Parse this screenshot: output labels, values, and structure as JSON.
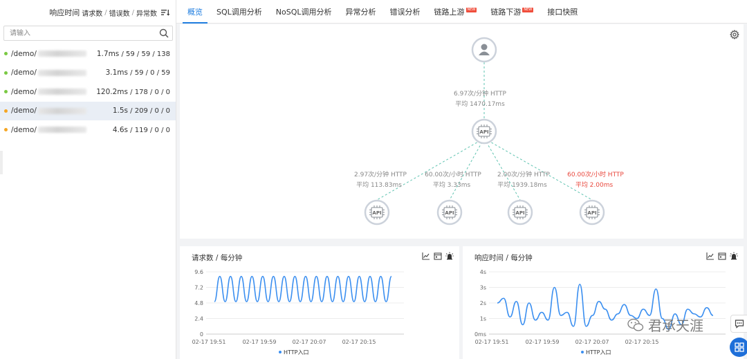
{
  "sort_bar": {
    "primary": "响应时间",
    "options": [
      "请求数",
      "错误数",
      "异常数"
    ],
    "sep": "/"
  },
  "search": {
    "placeholder": "请输入"
  },
  "endpoints": [
    {
      "path": "/demo/",
      "stats": "1.7ms",
      "counts": " / 59 / 59 / 138",
      "status": "ok",
      "active": false
    },
    {
      "path": "/demo/",
      "stats": "3.1ms",
      "counts": " / 59 / 0 / 59",
      "status": "ok",
      "active": false
    },
    {
      "path": "/demo/",
      "stats": "120.2ms",
      "counts": " / 178 / 0 / 0",
      "status": "ok",
      "active": false
    },
    {
      "path": "/demo/",
      "stats": "1.5s",
      "counts": " / 209 / 0 / 0",
      "status": "warn",
      "active": true
    },
    {
      "path": "/demo/",
      "stats": "4.6s",
      "counts": " / 119 / 0 / 0",
      "status": "warn",
      "active": false
    }
  ],
  "colors": {
    "ok": "#7ac943",
    "warn": "#f5a623",
    "accent": "#1f7ee0",
    "error": "#e9473c",
    "line": "#3b8ff0",
    "edge": "#5ec3b0"
  },
  "tabs": [
    {
      "label": "概览",
      "active": true,
      "badge": ""
    },
    {
      "label": "SQL调用分析",
      "active": false,
      "badge": ""
    },
    {
      "label": "NoSQL调用分析",
      "active": false,
      "badge": ""
    },
    {
      "label": "异常分析",
      "active": false,
      "badge": ""
    },
    {
      "label": "错误分析",
      "active": false,
      "badge": ""
    },
    {
      "label": "链路上游",
      "active": false,
      "badge": "NEW"
    },
    {
      "label": "链路下游",
      "active": false,
      "badge": "NEW"
    },
    {
      "label": "接口快照",
      "active": false,
      "badge": ""
    }
  ],
  "topology": {
    "root_icon": "user-icon",
    "center_label": "API",
    "incoming": {
      "rate": "6.97次/分钟 HTTP",
      "avg": "平均 1470.17ms"
    },
    "children": [
      {
        "label": "API",
        "rate": "2.97次/分钟 HTTP",
        "avg": "平均 113.83ms",
        "error": false
      },
      {
        "label": "API",
        "rate": "60.00次/小时 HTTP",
        "avg": "平均 3.33ms",
        "error": false
      },
      {
        "label": "API",
        "rate": "2.00次/分钟 HTTP",
        "avg": "平均 1939.18ms",
        "error": false
      },
      {
        "label": "API",
        "rate": "60.00次/小时 HTTP",
        "avg": "平均 2.00ms",
        "error": true
      }
    ]
  },
  "chart_data": [
    {
      "type": "line",
      "title": "请求数 / 每分钟",
      "ylim": [
        0,
        9.6
      ],
      "yticks": [
        "0",
        "2.4",
        "4.8",
        "7.2",
        "9.6"
      ],
      "xticks": [
        "02-17 19:51",
        "02-17 19:59",
        "02-17 20:07",
        "02-17 20:15"
      ],
      "legend": "HTTP入口",
      "grid": true,
      "series": [
        {
          "name": "HTTP入口",
          "values": [
            5.0,
            8.9,
            5.0,
            8.9,
            5.0,
            8.9,
            5.0,
            8.9,
            5.0,
            8.9,
            5.0,
            8.9,
            5.0,
            8.9,
            5.0,
            8.9,
            5.0,
            8.9,
            5.0,
            8.9,
            5.0,
            8.9,
            5.0,
            8.9,
            5.0,
            8.9,
            5.0,
            8.9,
            5.0,
            8.9,
            5.0,
            8.9,
            5.0,
            8.9
          ]
        }
      ]
    },
    {
      "type": "line",
      "title": "响应时间 / 每分钟",
      "ylim": [
        0,
        4
      ],
      "yticks": [
        "0ms",
        "1s",
        "2s",
        "3s",
        "4s"
      ],
      "xticks": [
        "02-17 19:51",
        "02-17 19:59",
        "02-17 20:07",
        "02-17 20:15"
      ],
      "legend": "HTTP入口",
      "grid": true,
      "series": [
        {
          "name": "HTTP入口",
          "values": [
            2.0,
            2.3,
            1.1,
            2.1,
            0.6,
            2.0,
            0.9,
            1.4,
            0.9,
            3.0,
            1.2,
            1.4,
            0.5,
            3.2,
            0.5,
            1.2,
            2.1,
            1.6,
            0.9,
            1.3,
            1.9,
            1.2,
            1.0,
            1.6,
            1.2,
            2.9,
            1.0,
            0.3,
            1.3,
            0.6,
            1.6,
            1.3,
            1.1,
            1.7,
            1.2
          ]
        }
      ]
    }
  ],
  "watermark": "君承天涯"
}
